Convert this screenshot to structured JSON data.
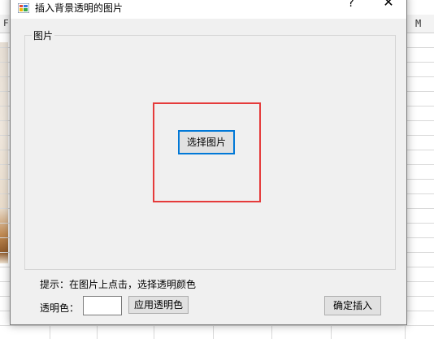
{
  "spreadsheet": {
    "col_left_letter": "F",
    "col_right_letter": "M"
  },
  "dialog": {
    "title": "插入背景透明的图片",
    "help_label": "?",
    "close_label": "✕",
    "group_label": "图片",
    "choose_button": "选择图片",
    "hint": "提示：在图片上点击，选择透明颜色",
    "transparent_color_label": "透明色：",
    "apply_button": "应用透明色",
    "confirm_button": "确定插入"
  },
  "colors": {
    "highlight_border": "#e53b3b",
    "focus_border": "#0078d7",
    "dialog_bg": "#f0f0f0"
  }
}
